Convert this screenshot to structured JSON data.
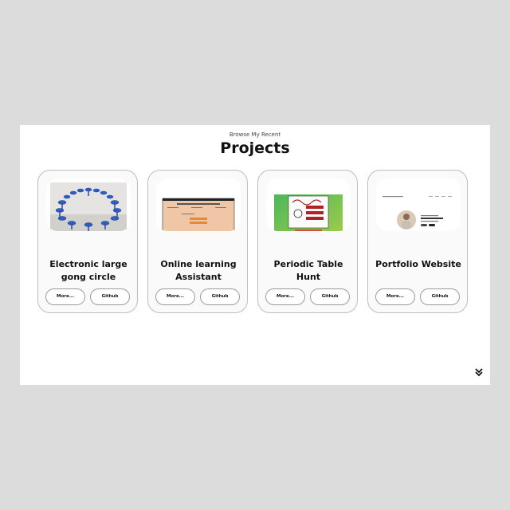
{
  "header": {
    "subtitle": "Browse My Recent",
    "title": "Projects"
  },
  "projects": [
    {
      "title": "Electronic large gong circle",
      "more_label": "More...",
      "github_label": "Github",
      "thumbnail": "gong-circle-photo"
    },
    {
      "title": "Online learning Assistant",
      "more_label": "More...",
      "github_label": "Github",
      "thumbnail": "online-learning-assistant-screenshot"
    },
    {
      "title": "Periodic Table Hunt",
      "more_label": "More...",
      "github_label": "Github",
      "thumbnail": "periodic-table-hunt-screenshot"
    },
    {
      "title": "Portfolio Website",
      "more_label": "More...",
      "github_label": "Github",
      "thumbnail": "portfolio-website-screenshot"
    }
  ],
  "icons": {
    "scroll_down": "double-chevron-down-icon"
  }
}
